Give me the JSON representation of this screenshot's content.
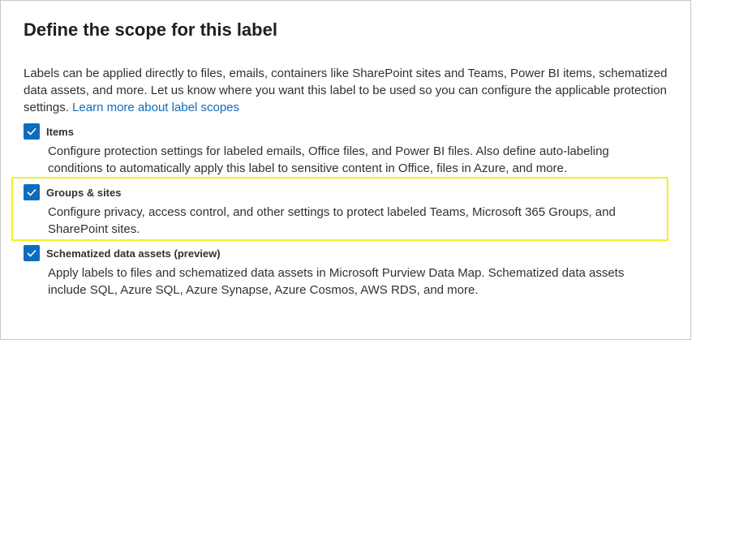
{
  "panel": {
    "title": "Define the scope for this label",
    "intro_text": "Labels can be applied directly to files, emails, containers like SharePoint sites and Teams, Power BI items, schematized data assets, and more. Let us know where you want this label to be used so you can configure the applicable protection settings.",
    "learn_more_link": "Learn more about label scopes",
    "accent_color": "#0f6cbd",
    "highlight_color": "#f5f024"
  },
  "options": [
    {
      "label": "Items",
      "checked": true,
      "description": "Configure protection settings for labeled emails, Office files, and Power BI files. Also define auto-labeling conditions to automatically apply this label to sensitive content in Office, files in Azure, and more."
    },
    {
      "label": "Groups & sites",
      "checked": true,
      "description": "Configure privacy, access control, and other settings to protect labeled Teams, Microsoft 365 Groups, and SharePoint sites."
    },
    {
      "label": "Schematized data assets (preview)",
      "checked": true,
      "description": "Apply labels to files and schematized data assets in Microsoft Purview Data Map. Schematized data assets include SQL, Azure SQL, Azure Synapse, Azure Cosmos, AWS RDS, and more."
    }
  ]
}
